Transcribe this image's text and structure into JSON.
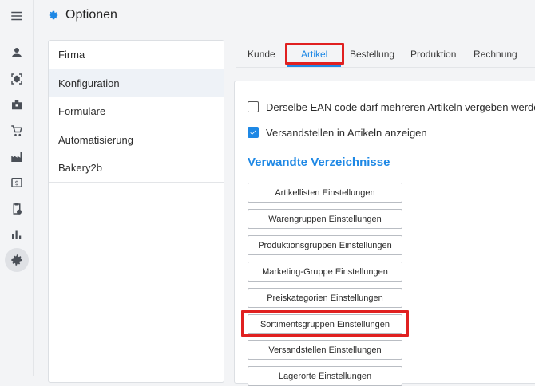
{
  "header": {
    "title": "Optionen",
    "icon": "gear-icon",
    "accent": "#1e88e5"
  },
  "sidebar_icons": [
    "menu-icon",
    "person-icon",
    "cube-scan-icon",
    "briefcase-icon",
    "cart-icon",
    "factory-icon",
    "invoice-icon",
    "clipboard-clock-icon",
    "bar-chart-icon",
    "settings-gear-icon"
  ],
  "nav": {
    "items": [
      {
        "label": "Firma"
      },
      {
        "label": "Konfiguration"
      },
      {
        "label": "Formulare"
      },
      {
        "label": "Automatisierung"
      },
      {
        "label": "Bakery2b"
      }
    ],
    "active": "Konfiguration"
  },
  "tabs": {
    "items": [
      {
        "label": "Kunde"
      },
      {
        "label": "Artikel"
      },
      {
        "label": "Bestellung"
      },
      {
        "label": "Produktion"
      },
      {
        "label": "Rechnung"
      }
    ],
    "active": "Artikel"
  },
  "options": [
    {
      "label": "Derselbe EAN code darf mehreren Artikeln vergeben werden",
      "checked": false
    },
    {
      "label": "Versandstellen in Artikeln anzeigen",
      "checked": true
    }
  ],
  "related": {
    "title": "Verwandte Verzeichnisse",
    "buttons": [
      {
        "label": "Artikellisten Einstellungen"
      },
      {
        "label": "Warengruppen Einstellungen"
      },
      {
        "label": "Produktionsgruppen Einstellungen"
      },
      {
        "label": "Marketing-Gruppe Einstellungen"
      },
      {
        "label": "Preiskategorien Einstellungen"
      },
      {
        "label": "Sortimentsgruppen Einstellungen"
      },
      {
        "label": "Versandstellen Einstellungen"
      },
      {
        "label": "Lagerorte Einstellungen"
      }
    ]
  },
  "highlight_color": "#e02020"
}
